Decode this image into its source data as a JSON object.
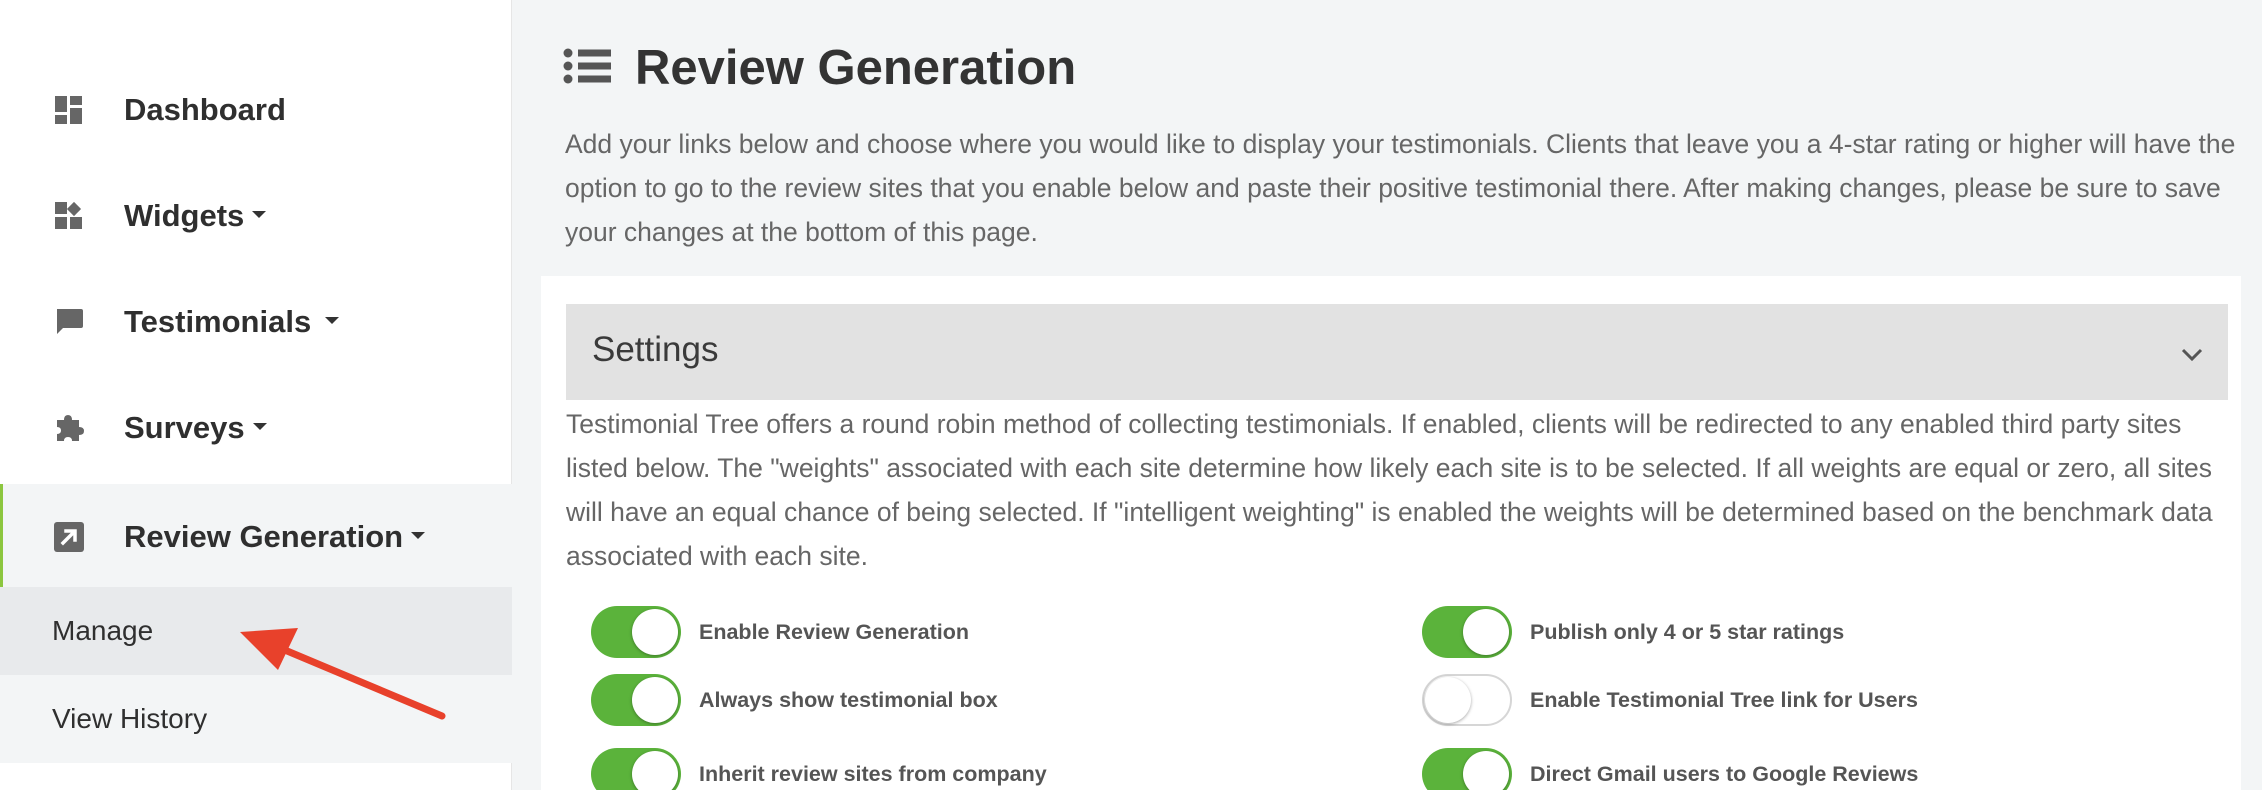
{
  "sidebar": {
    "items": [
      {
        "label": "Dashboard",
        "icon": "dashboard-icon",
        "has_caret": false
      },
      {
        "label": "Widgets",
        "icon": "widgets-icon",
        "has_caret": true
      },
      {
        "label": "Testimonials",
        "icon": "chat-icon",
        "has_caret": true
      },
      {
        "label": "Surveys",
        "icon": "puzzle-icon",
        "has_caret": true
      },
      {
        "label": "Review Generation",
        "icon": "external-link-icon",
        "has_caret": true,
        "active": true
      }
    ],
    "sub_items": [
      {
        "label": "Manage",
        "selected": true
      },
      {
        "label": "View History",
        "selected": false
      }
    ],
    "accent_color": "#8cc63f"
  },
  "main": {
    "title": "Review Generation",
    "title_icon": "list-icon",
    "intro": "Add your links below and choose where you would like to display your testimonials. Clients that leave you a 4-star rating or higher will have the option to go to the review sites that you enable below and paste their positive testimonial there. After making changes, please be sure to save your changes at the bottom of this page.",
    "settings": {
      "title": "Settings",
      "description": "Testimonial Tree offers a round robin method of collecting testimonials. If enabled, clients will be redirected to any enabled third party sites listed below. The \"weights\" associated with each site determine how likely each site is to be selected. If all weights are equal or zero, all sites will have an equal chance of being selected. If \"intelligent weighting\" is enabled the weights will be determined based on the benchmark data associated with each site.",
      "toggles": [
        {
          "label": "Enable Review Generation",
          "on": true
        },
        {
          "label": "Publish only 4 or 5 star ratings",
          "on": true
        },
        {
          "label": "Always show testimonial box",
          "on": true
        },
        {
          "label": "Enable Testimonial Tree link for Users",
          "on": false
        },
        {
          "label": "Inherit review sites from company",
          "on": true
        },
        {
          "label": "Direct Gmail users to Google Reviews",
          "on": true
        }
      ]
    }
  },
  "colors": {
    "toggle_on": "#5bb33b",
    "arrow": "#e8412b"
  }
}
